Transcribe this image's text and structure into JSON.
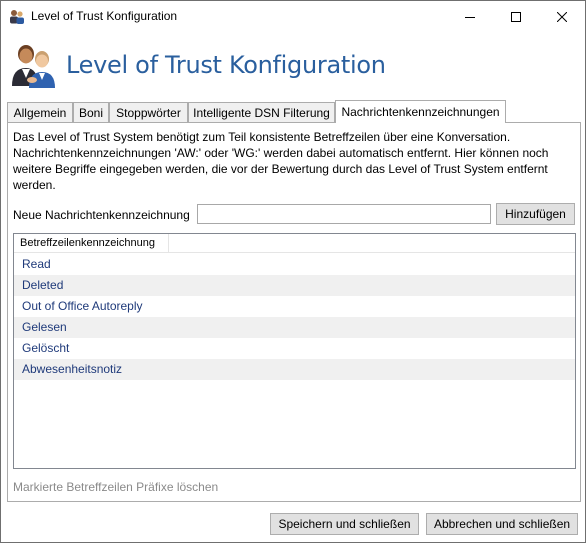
{
  "window": {
    "title": "Level of Trust Konfiguration",
    "icon": "users-icon",
    "controls": {
      "minimize": "minimize-icon",
      "maximize": "maximize-icon",
      "close": "close-icon"
    }
  },
  "header": {
    "title": "Level of Trust Konfiguration",
    "icon": "users-icon"
  },
  "tabs": [
    {
      "label": "Allgemein"
    },
    {
      "label": "Boni"
    },
    {
      "label": "Stoppwörter"
    },
    {
      "label": "Intelligente DSN Filterung"
    },
    {
      "label": "Nachrichtenkennzeichnungen"
    }
  ],
  "active_tab": "Nachrichtenkennzeichnungen",
  "panel": {
    "description": "Das Level of Trust System benötigt zum Teil konsistente Betreffzeilen über eine Konversation. Nachrichtenkennzeichnungen 'AW:' oder 'WG:' werden dabei automatisch entfernt. Hier können noch weitere Begriffe eingegeben werden, die vor der Bewertung durch das Level of Trust System entfernt werden.",
    "new_tag_label": "Neue Nachrichtenkennzeichnung",
    "new_tag_value": "",
    "add_button": "Hinzufügen",
    "list": {
      "column": "Betreffzeilenkennzeichnung",
      "items": [
        "Read",
        "Deleted",
        "Out of Office Autoreply",
        "Gelesen",
        "Gelöscht",
        "Abwesenheitsnotiz"
      ]
    },
    "delete_link": "Markierte Betreffzeilen Präfixe löschen"
  },
  "footer": {
    "save_button": "Speichern und schließen",
    "cancel_button": "Abbrechen und schließen"
  },
  "colors": {
    "header_title": "#2a5f9e",
    "list_text": "#1f3a7a",
    "disabled_text": "#8a8a8a"
  }
}
